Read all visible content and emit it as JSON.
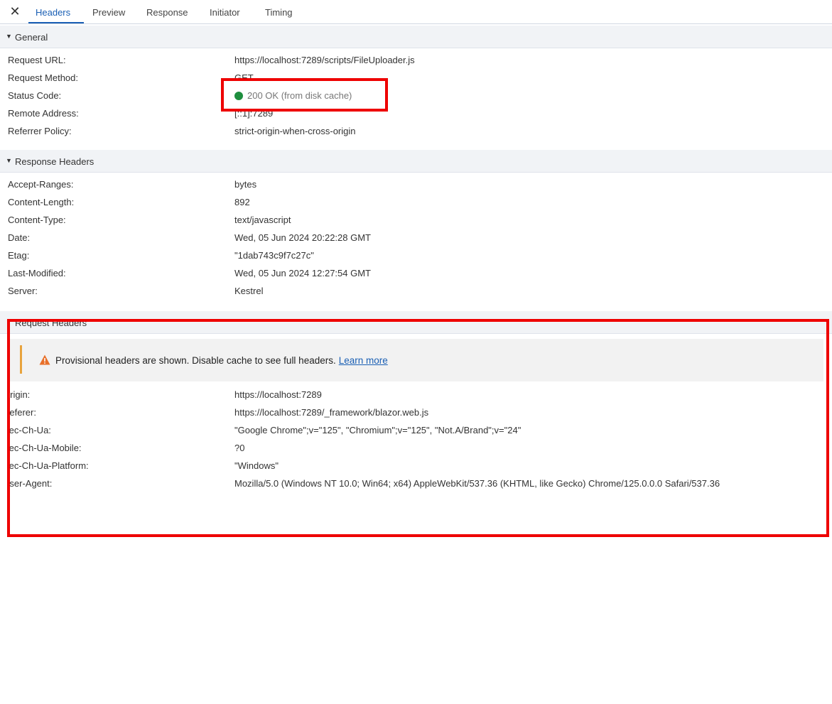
{
  "tabs": {
    "close_glyph": "✕",
    "headers": "Headers",
    "preview": "Preview",
    "response": "Response",
    "initiator": "Initiator",
    "timing": "Timing"
  },
  "general": {
    "title": "General",
    "rows": [
      {
        "key": "Request URL:",
        "value": "https://localhost:7289/scripts/FileUploader.js"
      },
      {
        "key": "Request Method:",
        "value": "GET"
      },
      {
        "key": "Status Code:",
        "value": "200 OK (from disk cache)"
      },
      {
        "key": "Remote Address:",
        "value": "[::1]:7289"
      },
      {
        "key": "Referrer Policy:",
        "value": "strict-origin-when-cross-origin"
      }
    ]
  },
  "response_headers": {
    "title": "Response Headers",
    "rows": [
      {
        "key": "Accept-Ranges:",
        "value": "bytes"
      },
      {
        "key": "Content-Length:",
        "value": "892"
      },
      {
        "key": "Content-Type:",
        "value": "text/javascript"
      },
      {
        "key": "Date:",
        "value": "Wed, 05 Jun 2024 20:22:28 GMT"
      },
      {
        "key": "Etag:",
        "value": "\"1dab743c9f7c27c\""
      },
      {
        "key": "Last-Modified:",
        "value": "Wed, 05 Jun 2024 12:27:54 GMT"
      },
      {
        "key": "Server:",
        "value": "Kestrel"
      }
    ]
  },
  "request_headers": {
    "title": "Request Headers",
    "warning": {
      "message": "Provisional headers are shown. Disable cache to see full headers.",
      "link": "Learn more"
    },
    "rows": [
      {
        "key": "Origin:",
        "value": "https://localhost:7289"
      },
      {
        "key": "Referer:",
        "value": "https://localhost:7289/_framework/blazor.web.js"
      },
      {
        "key": "Sec-Ch-Ua:",
        "value": "\"Google Chrome\";v=\"125\", \"Chromium\";v=\"125\", \"Not.A/Brand\";v=\"24\""
      },
      {
        "key": "Sec-Ch-Ua-Mobile:",
        "value": "?0"
      },
      {
        "key": "Sec-Ch-Ua-Platform:",
        "value": "\"Windows\""
      },
      {
        "key": "User-Agent:",
        "value": "Mozilla/5.0 (Windows NT 10.0; Win64; x64) AppleWebKit/537.36 (KHTML, like Gecko) Chrome/125.0.0.0 Safari/537.36"
      }
    ]
  },
  "colors": {
    "accent": "#1a5fb4",
    "status_ok": "#1e8e3e",
    "warning": "#e8a33d",
    "highlight": "#ee0000"
  }
}
